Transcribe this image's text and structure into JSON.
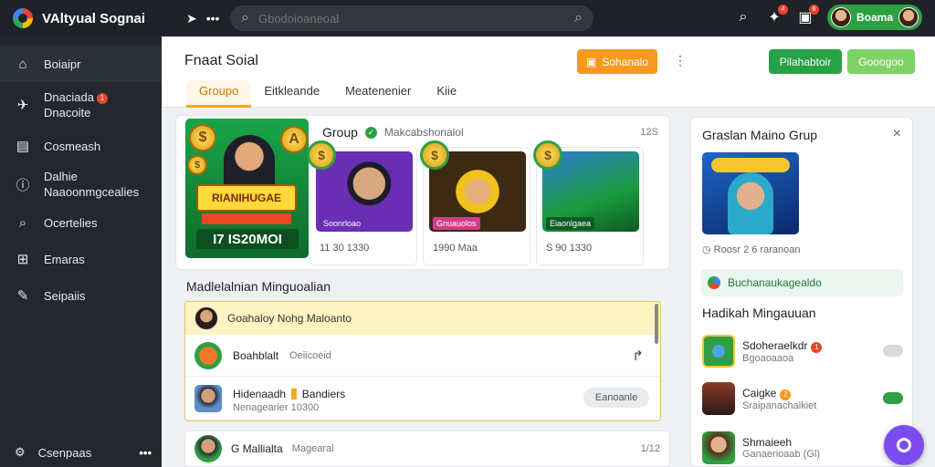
{
  "topbar": {
    "app_title": "VAltyual Sognai",
    "search_placeholder": "Gbodoioaneoal",
    "profile_name": "Boama",
    "notif_badge_1": "4",
    "notif_badge_2": "8"
  },
  "sidebar": {
    "items": [
      {
        "label": "Boiaipr",
        "icon": "home-icon"
      },
      {
        "label": "Dnaciada",
        "label2": "Dnacoite",
        "badge": "1",
        "icon": "bird-icon"
      },
      {
        "label": "Cosmeash",
        "icon": "card-icon"
      },
      {
        "label": "Dalhie",
        "label2": "Naaoonmgcealies",
        "icon": "info-icon"
      },
      {
        "label": "Ocertelies",
        "icon": "search-icon"
      },
      {
        "label": "Emaras",
        "icon": "grid-icon"
      },
      {
        "label": "Seipaiis",
        "icon": "pin-icon"
      }
    ],
    "footer_label": "Csenpaas"
  },
  "header": {
    "page_title": "Fnaat Soial",
    "orange_button": "Sohanalo",
    "green_button": "Pilahabtoir",
    "light_green_button": "Gooogoo",
    "tabs": [
      "Groupo",
      "Eitkleande",
      "Meatenenier",
      "Kiie"
    ]
  },
  "group": {
    "title": "Group",
    "subtitle": "Makcabshonalol",
    "count": "12S",
    "hero_banner": "RIANIHUGAE",
    "hero_amount": "I7 IS20MOI",
    "thumbs": [
      {
        "caption": "11 30 1330",
        "tag": "Soonrloao"
      },
      {
        "caption": "1990 Maa",
        "tag": "Gnuauolos"
      },
      {
        "caption": "S 90 1330",
        "tag": "Eiaonlgaea"
      }
    ]
  },
  "section": {
    "title": "Madlelalnian Minguoalian",
    "list_head": "Goahaloy Nohg Maloanto",
    "rows": [
      {
        "name": "Boahblalt",
        "sub": "Oeiicoeid"
      },
      {
        "name": "Hidenaadh",
        "name2": "Bandiers",
        "sub": "Nenagearier 10300",
        "action": "Eanoanle"
      }
    ],
    "feed_item": {
      "name": "G Mallialta",
      "sub": "Magearal",
      "count": "1/12"
    }
  },
  "right_panel": {
    "title": "Graslan Maino Grup",
    "meta": "Roosr 2 6 raranoan",
    "tag": "Buchanaukagealdo",
    "sec_title": "Hadikah Mingauuan",
    "rows": [
      {
        "name": "Sdoheraelkdr",
        "sub": "Bgoaoaaoa",
        "badge": "1"
      },
      {
        "name": "Caigke",
        "sub": "Sraipanachalkiet",
        "badge": "2"
      },
      {
        "name": "Shmaieeh",
        "sub": "Ganaerioaab (Gl)"
      }
    ]
  },
  "colors": {
    "topbar": "#1f2228",
    "sidebar": "#24272d",
    "accent_green": "#2ea043",
    "accent_orange": "#f79a1f",
    "fab": "#7c4cf0"
  }
}
